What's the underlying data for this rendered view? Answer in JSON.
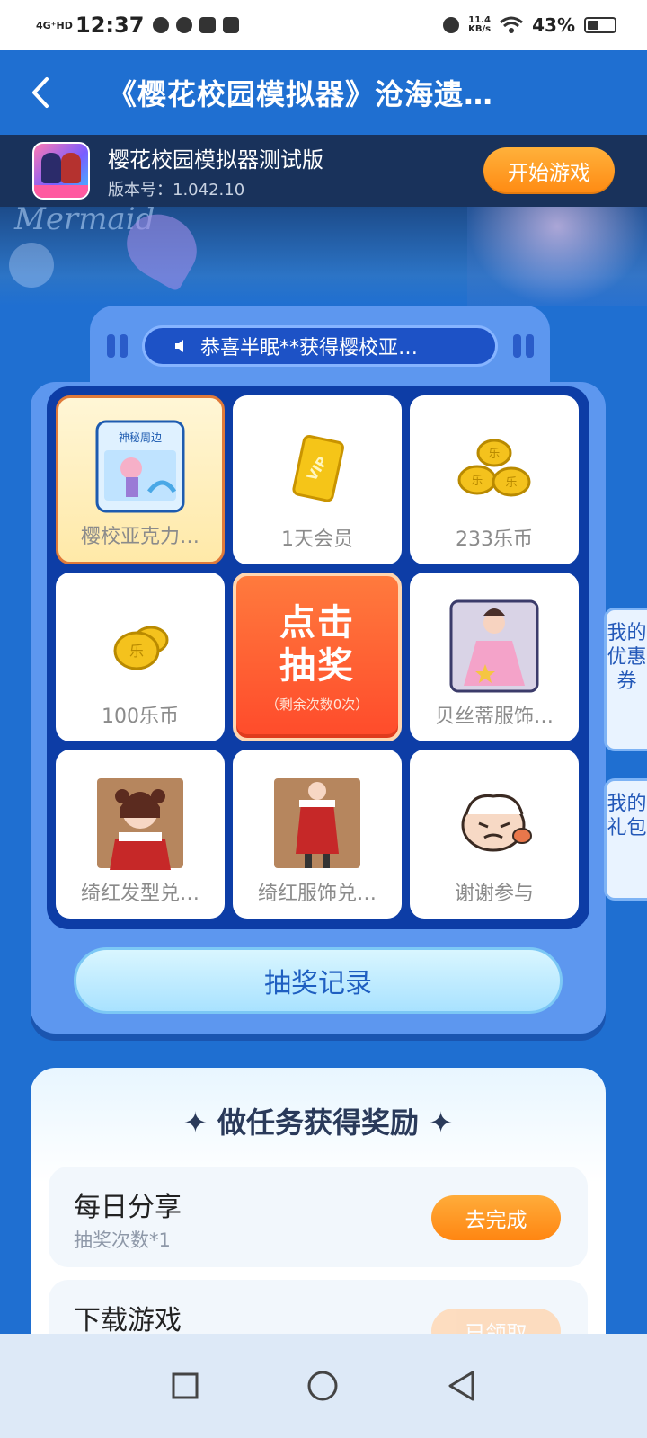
{
  "status_bar": {
    "network": "4G⁺HD",
    "time": "12:37",
    "speed_value": "11.4",
    "speed_unit": "KB/s",
    "battery": "43%"
  },
  "header": {
    "title": "《樱花校园模拟器》沧海遗…"
  },
  "game": {
    "name": "樱花校园模拟器测试版",
    "version": "版本号：1.042.10",
    "start_label": "开始游戏"
  },
  "lottery": {
    "marquee_text": "恭喜半眠**获得樱校亚…",
    "prizes": [
      {
        "label": "樱校亚克力…",
        "icon": "acrylic-card-icon",
        "selected": true
      },
      {
        "label": "1天会员",
        "icon": "vip-card-icon"
      },
      {
        "label": "233乐币",
        "icon": "coins-stack-icon"
      },
      {
        "label": "100乐币",
        "icon": "coins-icon"
      },
      {
        "label": "贝丝蒂服饰…",
        "icon": "pink-dress-icon"
      },
      {
        "label": "绮红发型兑…",
        "icon": "red-hair-avatar-icon"
      },
      {
        "label": "绮红服饰兑…",
        "icon": "red-outfit-icon"
      },
      {
        "label": "谢谢参与",
        "icon": "thanks-face-icon"
      }
    ],
    "draw_line1": "点击",
    "draw_line2": "抽奖",
    "draw_remaining": "（剩余次数0次）",
    "acrylic_title": "神秘周边",
    "vip_text": "VIP",
    "coin_glyph": "乐",
    "record_label": "抽奖记录"
  },
  "side_tabs": {
    "coupons": "我的优惠券",
    "gifts": "我的礼包"
  },
  "tasks": {
    "title": "✦ 做任务获得奖励 ✦",
    "items": [
      {
        "name": "每日分享",
        "desc": "抽奖次数*1",
        "button": "去完成"
      },
      {
        "name": "下载游戏",
        "desc": "",
        "button": "已领取"
      }
    ]
  },
  "banner_text": "Mermaid",
  "colors": {
    "primary_blue": "#1f6fd1",
    "accent_orange": "#ff8a12",
    "panel_blue": "#5d97ef",
    "grid_navy": "#0d3da6"
  }
}
